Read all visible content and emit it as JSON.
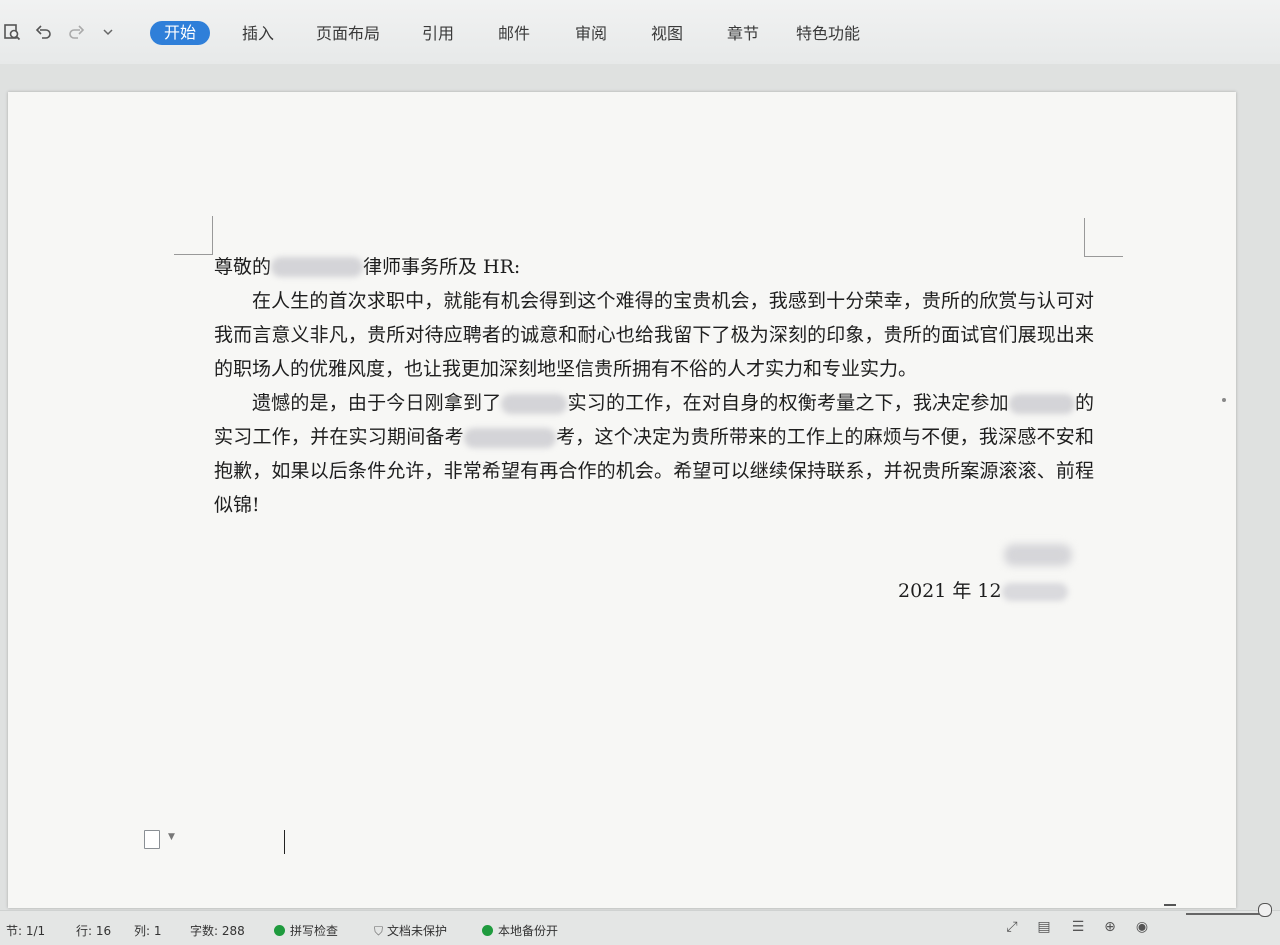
{
  "toolbar": {
    "icons": [
      "print-preview-icon",
      "undo-icon",
      "redo-icon",
      "customize-icon"
    ],
    "tabs": [
      {
        "label": "开始",
        "active": true
      },
      {
        "label": "插入",
        "active": false
      },
      {
        "label": "页面布局",
        "active": false
      },
      {
        "label": "引用",
        "active": false
      },
      {
        "label": "邮件",
        "active": false
      },
      {
        "label": "审阅",
        "active": false
      },
      {
        "label": "视图",
        "active": false
      },
      {
        "label": "章节",
        "active": false
      },
      {
        "label": "特色功能",
        "active": false
      }
    ],
    "accent_color": "#2f7fd9"
  },
  "document": {
    "greeting_prefix": "尊敬的",
    "greeting_suffix": "律师事务所及 HR:",
    "para1": "在人生的首次求职中，就能有机会得到这个难得的宝贵机会，我感到十分荣幸，贵所的欣赏与认可对我而言意义非凡，贵所对待应聘者的诚意和耐心也给我留下了极为深刻的印象，贵所的面试官们展现出来的职场人的优雅风度，也让我更加深刻地坚信贵所拥有不俗的人才实力和专业实力。",
    "para2_a": "遗憾的是，由于今日刚拿到了",
    "para2_b": "实习的工作，在对自身的权衡考量之下，我决定参加",
    "para2_c": "的实习工作，并在实习期间备考",
    "para2_d": "考，这个决定为贵所带来的工作上的麻烦与不便，我深感不安和抱歉，如果以后条件允许，非常希望有再合作的机会。希望可以继续保持联系，并祝贵所案源滚滚、前程似锦!",
    "date": "2021 年 12"
  },
  "status": {
    "section": "节: 1/1",
    "line": "行: 16",
    "column": "列: 1",
    "word_count": "字数: 288",
    "spell_check": "拼写检查",
    "doc_protect": "文档未保护",
    "local_backup": "本地备份开"
  }
}
